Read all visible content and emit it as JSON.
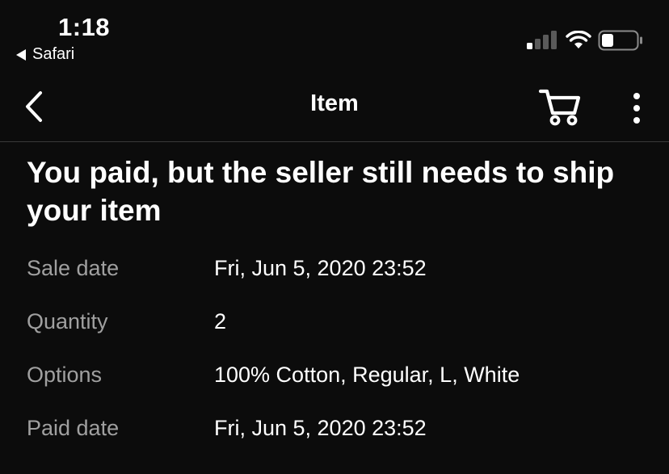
{
  "status_bar": {
    "time": "1:18",
    "back_app_label": "Safari",
    "signal_bars_active": 1,
    "signal_bars_total": 4,
    "battery_level": 0.3
  },
  "nav": {
    "title": "Item",
    "icons": [
      "chevron-left-icon",
      "cart-icon",
      "more-vertical-icon"
    ]
  },
  "headline": "You paid, but the seller still needs to ship your item",
  "details": [
    {
      "label": "Sale date",
      "value": "Fri, Jun 5, 2020 23:52"
    },
    {
      "label": "Quantity",
      "value": "2"
    },
    {
      "label": "Options",
      "value": "100% Cotton, Regular, L, White"
    },
    {
      "label": "Paid date",
      "value": "Fri, Jun 5, 2020 23:52"
    }
  ],
  "colors": {
    "background": "#0c0c0c",
    "text": "#ffffff",
    "label": "#a0a0a0",
    "divider": "#3a3a3a"
  }
}
